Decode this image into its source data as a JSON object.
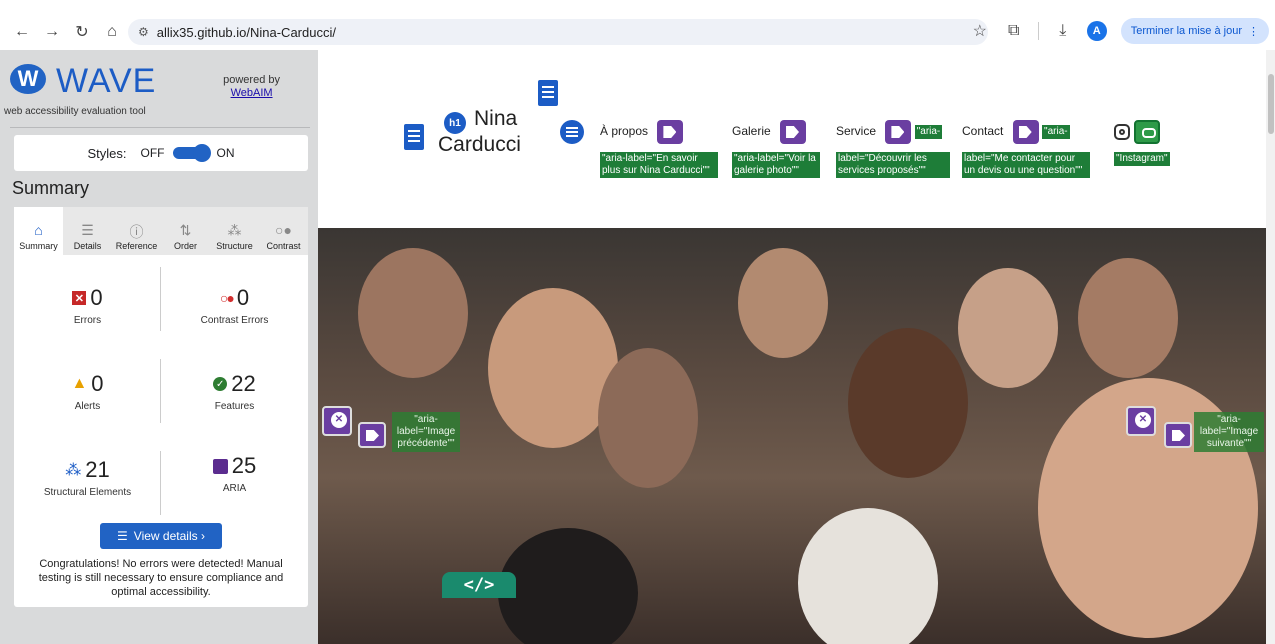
{
  "browser": {
    "url": "allix35.github.io/Nina-Carducci/",
    "profile_initial": "A",
    "update_label": "Terminer la mise à jour"
  },
  "wave": {
    "title": "WAVE",
    "subtitle": "web accessibility evaluation tool",
    "powered_by": "powered by",
    "webaim": "WebAIM",
    "styles_label": "Styles:",
    "styles_off": "OFF",
    "styles_on": "ON",
    "summary_title": "Summary",
    "tabs": [
      {
        "label": "Summary",
        "icon": "home-icon"
      },
      {
        "label": "Details",
        "icon": "list-icon"
      },
      {
        "label": "Reference",
        "icon": "info-icon"
      },
      {
        "label": "Order",
        "icon": "order-icon"
      },
      {
        "label": "Structure",
        "icon": "structure-icon"
      },
      {
        "label": "Contrast",
        "icon": "contrast-icon"
      }
    ],
    "stats": {
      "errors": {
        "value": "0",
        "label": "Errors"
      },
      "contrast_errors": {
        "value": "0",
        "label": "Contrast Errors"
      },
      "alerts": {
        "value": "0",
        "label": "Alerts"
      },
      "features": {
        "value": "22",
        "label": "Features"
      },
      "structural": {
        "value": "21",
        "label": "Structural Elements"
      },
      "aria": {
        "value": "25",
        "label": "ARIA"
      }
    },
    "view_details": "View details ›",
    "congrats": "Congratulations! No errors were detected! Manual testing is still necessary to ensure compliance and optimal accessibility.",
    "colors": {
      "brand": "#2163c4",
      "aria": "#5b2c8f",
      "feature": "#2e7d32",
      "error": "#c62828",
      "alert": "#e8a100"
    }
  },
  "site": {
    "h1_badge": "h1",
    "name_line1": "Nina",
    "name_line2": "Carducci",
    "nav": [
      {
        "label": "À propos",
        "aria": "\"aria-label=\"En savoir plus sur Nina Carducci\"\""
      },
      {
        "label": "Galerie",
        "aria": "\"aria-label=\"Voir la galerie photo\"\""
      },
      {
        "label": "Service",
        "aria_inline": "\"aria-",
        "aria": "label=\"Découvrir les services proposés\"\""
      },
      {
        "label": "Contact",
        "aria_inline": "\"aria-",
        "aria": "label=\"Me contacter pour un devis ou une question\"\""
      }
    ],
    "instagram_aria": "\"Instagram\"",
    "prev_label": "\"aria-label=\"Image précédente\"\"",
    "next_label": "\"aria-label=\"Image suivante\"\"",
    "code_toggle": "</>"
  }
}
